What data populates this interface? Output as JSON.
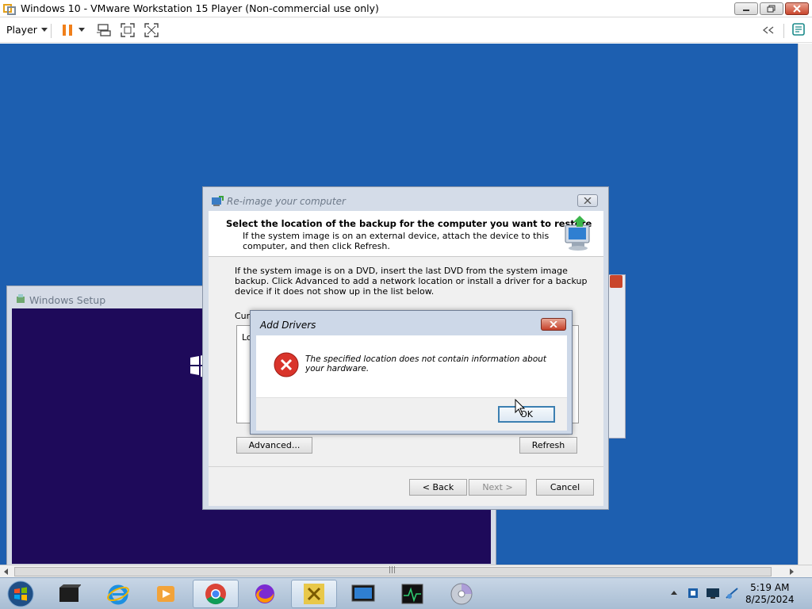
{
  "host": {
    "title": "Windows 10 - VMware Workstation 15 Player (Non-commercial use only)",
    "player_menu": "Player"
  },
  "setup_window": {
    "title": "Windows Setup"
  },
  "reimage": {
    "title": "Re-image your computer",
    "heading": "Select the location of the backup for the computer you want to restore",
    "subheading": "If the system image is on an external device, attach the device to this computer, and then click Refresh.",
    "description": "If the system image is on a DVD, insert the last DVD from the system image backup. Click Advanced to add a network location or install a driver for a backup device if it does not show up in the list below.",
    "current_label_partial": "Cur",
    "list_item_partial": "Lo",
    "advanced_button": "Advanced...",
    "refresh_button": "Refresh",
    "back_button": "< Back",
    "next_button": "Next >",
    "cancel_button": "Cancel"
  },
  "add_drivers": {
    "title": "Add Drivers",
    "message": "The specified location does not contain information about your hardware.",
    "ok_button": "OK"
  },
  "taskbar": {
    "apps": [
      "start-orb",
      "vmware-app",
      "internet-explorer",
      "media-player",
      "chrome",
      "firefox",
      "file-tool",
      "remote-desktop",
      "task-monitor",
      "disc-burner"
    ],
    "time": "5:19 AM",
    "date": "8/25/2024"
  }
}
